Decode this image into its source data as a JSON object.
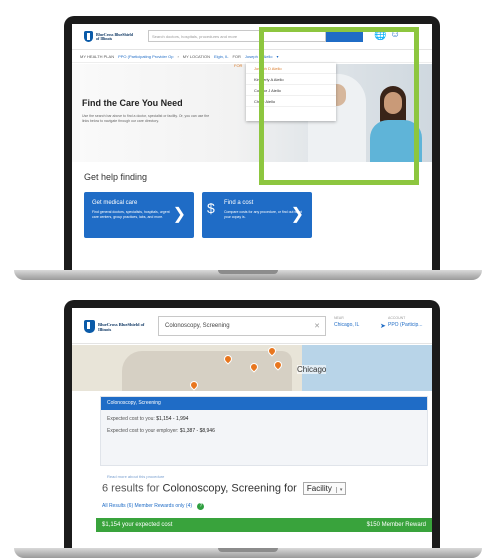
{
  "screen1": {
    "logo_text": "BlueCross BlueShield of Illinois",
    "search_placeholder": "Search doctors, hospitals, procedures and more",
    "subnav": {
      "my_health_plan": "MY HEALTH PLAN",
      "plan_name": "PPO (Participating Provider Op",
      "my_location": "MY LOCATION",
      "location_value": "Elgin, IL",
      "for_label": "FOR",
      "for_value": "Joseph D Aiello"
    },
    "dropdown": {
      "for_label": "FOR",
      "options": [
        "Joseph D Aiello",
        "Kimberly A Aiello",
        "Connor J Aiello",
        "Chloe Aiello"
      ]
    },
    "hero": {
      "title": "Find the Care You Need",
      "description": "Use the search bar above to find a doctor, specialist or facility. Or, you can use the links below to navigate through our care directory."
    },
    "help_title": "Get help finding",
    "cards": [
      {
        "title": "Get medical care",
        "description": "Find general doctors, specialists, hospitals, urgent care centers, group practices, labs, and more."
      },
      {
        "title": "Find a cost",
        "description": "Compare costs for any procedure, or find out what your copay is."
      }
    ]
  },
  "screen2": {
    "logo_text": "BlueCross BlueShield of Illinois",
    "search_value": "Colonoscopy, Screening",
    "near_label": "NEAR",
    "near_value": "Chicago, IL",
    "account_label": "ACCOUNT",
    "account_value": "PPO (Particip...",
    "map_label": "Chicago",
    "map_pins": [
      "7",
      "5",
      "3"
    ],
    "panel": {
      "title": "Colonoscopy, Screening",
      "cost_you_label": "Expected cost to you:",
      "cost_you_value": "$1,154 - 1,994",
      "cost_employer_label": "Expected cost to your employer:",
      "cost_employer_value": "$1,387 - $8,946",
      "more_link": "Read more about this procedure"
    },
    "results": {
      "prefix": "6 results for",
      "query": "Colonoscopy, Screening for",
      "filter": "Facility",
      "tabs": "All Results (6)  Member Rewards only (4)"
    },
    "result_bar": {
      "left": "$1,154 your expected cost",
      "right": "$150 Member Reward"
    }
  }
}
